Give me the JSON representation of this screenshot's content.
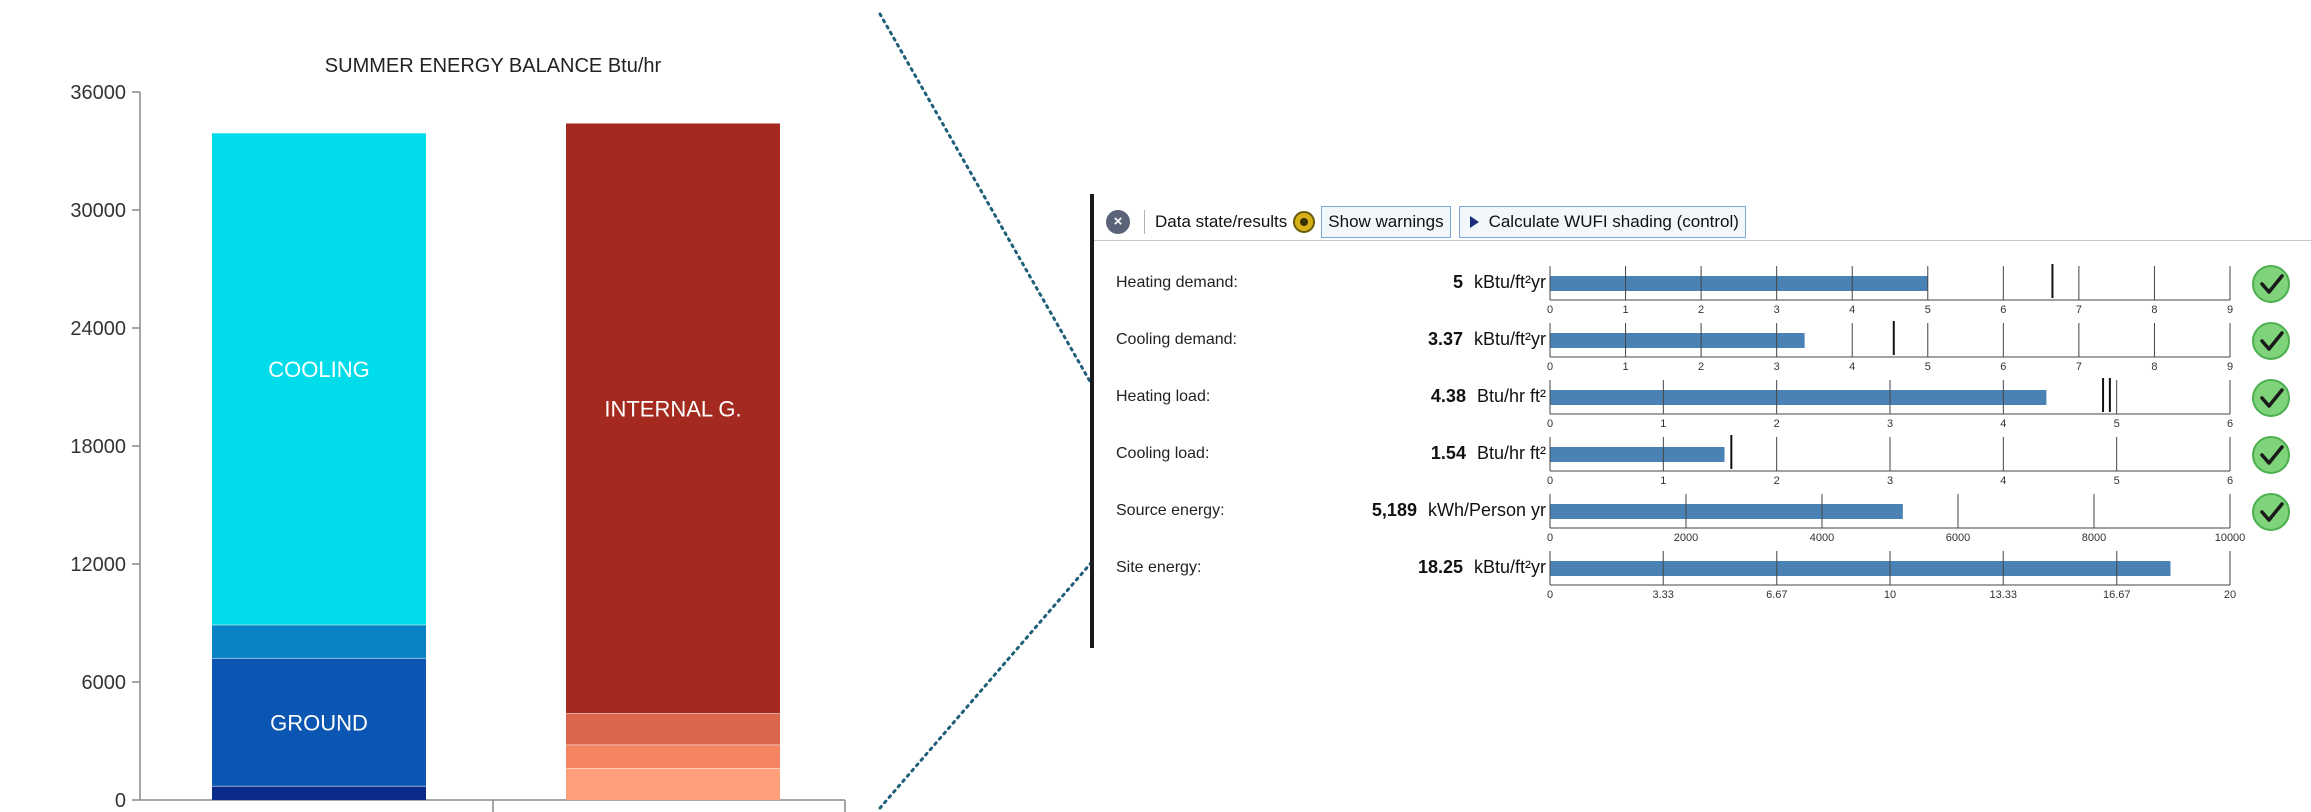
{
  "chart_data": [
    {
      "type": "bar",
      "stacked": true,
      "title": "SUMMER ENERGY BALANCE Btu/hr",
      "ylim": [
        0,
        36000
      ],
      "y_ticks": [
        "36000",
        "30000",
        "24000",
        "18000",
        "12000",
        "6000",
        "0"
      ],
      "categories": [
        "",
        ""
      ],
      "grid": false,
      "bars": [
        {
          "segments": [
            {
              "from": 0,
              "to": 700,
              "color": "#0a2a8c"
            },
            {
              "from": 700,
              "to": 7200,
              "color": "#0b56b3",
              "label": "GROUND"
            },
            {
              "from": 7200,
              "to": 8900,
              "color": "#0a82c6"
            },
            {
              "from": 8900,
              "to": 33900,
              "color": "#00dcea",
              "label": "COOLING"
            }
          ]
        },
        {
          "segments": [
            {
              "from": 0,
              "to": 1600,
              "color": "#ff9f7a"
            },
            {
              "from": 1600,
              "to": 2800,
              "color": "#f58462"
            },
            {
              "from": 2800,
              "to": 4400,
              "color": "#d9664d"
            },
            {
              "from": 4400,
              "to": 34400,
              "color": "#a42a20",
              "label": "INTERNAL G."
            }
          ]
        }
      ]
    },
    {
      "type": "bar",
      "orientation": "horizontal",
      "bar_color": "#4a82b6",
      "rows": [
        {
          "label": "Heating demand:",
          "value_text": "5",
          "unit": "kBtu/ft²yr",
          "value": 5,
          "ticks": [
            "0",
            "1",
            "2",
            "3",
            "4",
            "5",
            "6",
            "7",
            "8",
            "9"
          ],
          "max": 9,
          "markers": [
            6.65
          ],
          "check": true
        },
        {
          "label": "Cooling demand:",
          "value_text": "3.37",
          "unit": "kBtu/ft²yr",
          "value": 3.37,
          "ticks": [
            "0",
            "1",
            "2",
            "3",
            "4",
            "5",
            "6",
            "7",
            "8",
            "9"
          ],
          "max": 9,
          "markers": [
            4.55
          ],
          "check": true
        },
        {
          "label": "Heating load:",
          "value_text": "4.38",
          "unit": "Btu/hr ft²",
          "value": 4.38,
          "ticks": [
            "0",
            "1",
            "2",
            "3",
            "4",
            "5",
            "6"
          ],
          "max": 6,
          "markers": [
            4.88,
            4.94
          ],
          "check": true
        },
        {
          "label": "Cooling load:",
          "value_text": "1.54",
          "unit": "Btu/hr ft²",
          "value": 1.54,
          "ticks": [
            "0",
            "1",
            "2",
            "3",
            "4",
            "5",
            "6"
          ],
          "max": 6,
          "markers": [
            1.6
          ],
          "check": true
        },
        {
          "label": "Source energy:",
          "value_text": "5,189",
          "unit": "kWh/Person yr",
          "value": 5189,
          "ticks": [
            "0",
            "2000",
            "4000",
            "6000",
            "8000",
            "10000"
          ],
          "max": 10000,
          "markers": [],
          "check": true
        },
        {
          "label": "Site energy:",
          "value_text": "18.25",
          "unit": "kBtu/ft²yr",
          "value": 18.25,
          "ticks": [
            "0",
            "3.33",
            "6.67",
            "10",
            "13.33",
            "16.67",
            "20"
          ],
          "max": 20,
          "markers": [],
          "check": false
        }
      ]
    }
  ],
  "toolbar": {
    "close_icon": "close-icon",
    "data_state_label": "Data state/results",
    "status_icon": "gear-icon",
    "show_warnings_label": "Show warnings",
    "calculate_label": "Calculate WUFI shading (control)"
  },
  "colors": {
    "check_green": "#4caf50",
    "connector": "#1f5f7a"
  }
}
